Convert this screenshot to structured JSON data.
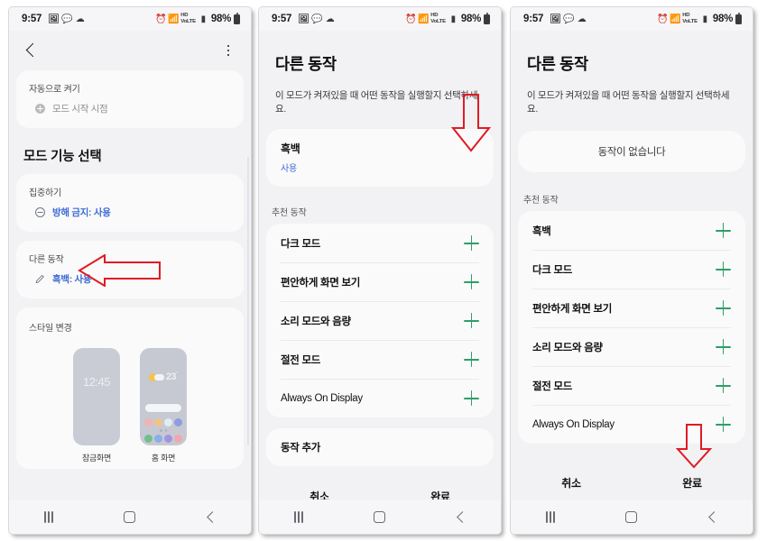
{
  "statusbar": {
    "time": "9:57",
    "left_icons": [
      "gallery-icon",
      "message-icon",
      "cloud-icon"
    ],
    "right_icons": [
      "alarm-icon",
      "wifi-icon",
      "hd-icon",
      "signal-icon"
    ],
    "hd_top": "HD",
    "hd_bottom": "VoLTE",
    "battery_percent": "98%"
  },
  "navbar": {
    "recent": "recents-button",
    "home": "home-button",
    "back": "back-button"
  },
  "panel1": {
    "appbar": {
      "back": "back-button",
      "menu": "more-options-button"
    },
    "auto_on": {
      "label": "자동으로 켜기",
      "chip_icon": "plus-circle-icon",
      "chip_text": "모드 시작 시점"
    },
    "section_title": "모드 기능 선택",
    "focus": {
      "label": "집중하기",
      "chip_icon": "do-not-disturb-icon",
      "chip_text": "방해 금지: 사용"
    },
    "other_actions": {
      "label": "다른 동작",
      "chip_icon": "pencil-icon",
      "chip_text": "흑백: 사용"
    },
    "style": {
      "label": "스타일 변경",
      "lock_preview": {
        "caption": "잠금화면",
        "clock": "12:45"
      },
      "home_preview": {
        "caption": "홈 화면",
        "temperature": "23",
        "degree": "°"
      }
    }
  },
  "panel2": {
    "title": "다른 동작",
    "subtitle": "이 모드가 켜져있을 때 어떤 동작을 실행할지 선택하세요.",
    "selected": {
      "title": "흑백",
      "status": "사용"
    },
    "recommended_header": "추천 동작",
    "recommended": [
      {
        "label": "다크 모드",
        "add_icon": "plus-icon",
        "latin": false
      },
      {
        "label": "편안하게 화면 보기",
        "add_icon": "plus-icon",
        "latin": false
      },
      {
        "label": "소리 모드와 음량",
        "add_icon": "plus-icon",
        "latin": false
      },
      {
        "label": "절전 모드",
        "add_icon": "plus-icon",
        "latin": false
      },
      {
        "label": "Always On Display",
        "add_icon": "plus-icon",
        "latin": true
      }
    ],
    "add_action": "동작 추가",
    "buttons": {
      "cancel": "취소",
      "done": "완료"
    }
  },
  "panel3": {
    "title": "다른 동작",
    "subtitle": "이 모드가 켜져있을 때 어떤 동작을 실행할지 선택하세요.",
    "empty_text": "동작이 없습니다",
    "recommended_header": "추천 동작",
    "recommended": [
      {
        "label": "흑백",
        "add_icon": "plus-icon",
        "latin": false
      },
      {
        "label": "다크 모드",
        "add_icon": "plus-icon",
        "latin": false
      },
      {
        "label": "편안하게 화면 보기",
        "add_icon": "plus-icon",
        "latin": false
      },
      {
        "label": "소리 모드와 음량",
        "add_icon": "plus-icon",
        "latin": false
      },
      {
        "label": "절전 모드",
        "add_icon": "plus-icon",
        "latin": false
      },
      {
        "label": "Always On Display",
        "add_icon": "plus-icon",
        "latin": true
      }
    ],
    "buttons": {
      "cancel": "취소",
      "done": "완료"
    }
  },
  "annotations": [
    {
      "name": "arrow-left-other-actions",
      "direction": "left",
      "color": "#e01b24"
    },
    {
      "name": "arrow-down-blackwhite",
      "direction": "down",
      "color": "#e01b24"
    },
    {
      "name": "arrow-down-done",
      "direction": "down",
      "color": "#e01b24"
    }
  ],
  "colors": {
    "accent_blue": "#3d6bd6",
    "accent_green": "#2f9e68",
    "annotation_red": "#e01b24",
    "card_bg": "#fafafa",
    "screen_bg": "#f2f2f4"
  }
}
